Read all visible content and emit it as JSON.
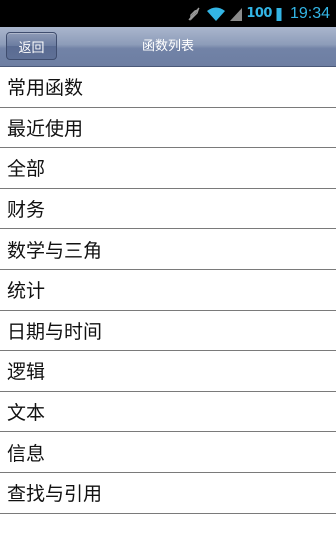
{
  "status_bar": {
    "battery_text": "100",
    "time": "19:34",
    "icons": [
      "mute-icon",
      "wifi-icon",
      "signal-icon",
      "battery-icon"
    ],
    "accent_color": "#33b5e5"
  },
  "header": {
    "back_label": "返回",
    "title": "函数列表"
  },
  "list": {
    "items": [
      {
        "label": "常用函数"
      },
      {
        "label": "最近使用"
      },
      {
        "label": "全部"
      },
      {
        "label": "财务"
      },
      {
        "label": "数学与三角"
      },
      {
        "label": "统计"
      },
      {
        "label": "日期与时间"
      },
      {
        "label": "逻辑"
      },
      {
        "label": "文本"
      },
      {
        "label": "信息"
      },
      {
        "label": "查找与引用"
      }
    ]
  }
}
